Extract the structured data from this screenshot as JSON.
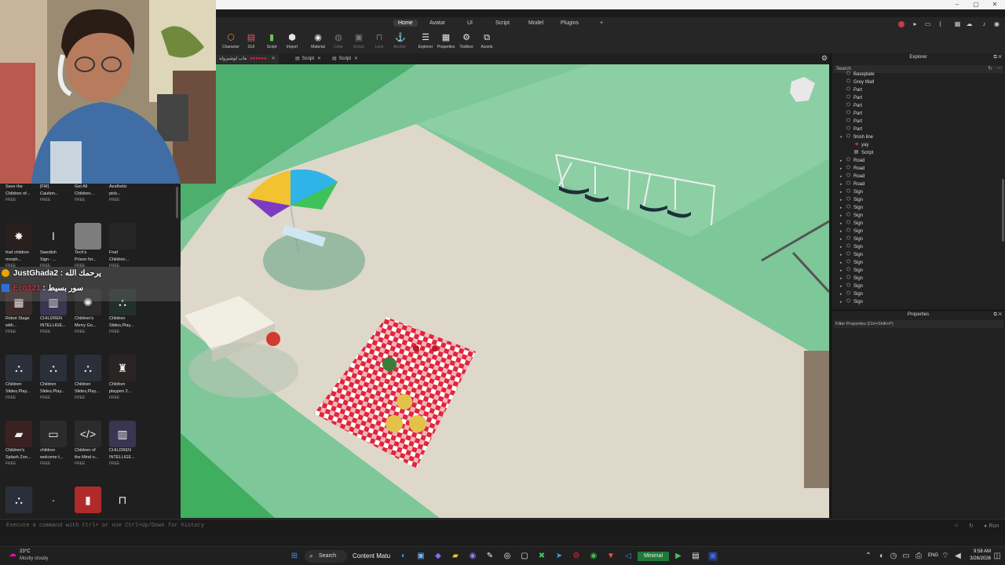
{
  "window": {
    "min": "–",
    "max": "▢",
    "close": "✕"
  },
  "menu_tabs": [
    {
      "label": "Home",
      "active": true
    },
    {
      "label": "Avatar"
    },
    {
      "label": "UI"
    },
    {
      "label": "Script"
    },
    {
      "label": "Model"
    },
    {
      "label": "Plugins"
    },
    {
      "label": "+"
    }
  ],
  "toolbar": [
    {
      "label": "Character",
      "icon": "⬡"
    },
    {
      "label": "GUI",
      "icon": "▤"
    },
    {
      "label": "Script",
      "icon": "▮"
    },
    {
      "label": "Import",
      "icon": "⬢"
    },
    {
      "label": "Material",
      "icon": "◉"
    },
    {
      "label": "Color",
      "icon": "◍",
      "dim": true
    },
    {
      "label": "Group",
      "icon": "▣",
      "dim": true
    },
    {
      "label": "Lock",
      "icon": "🔒",
      "dim": true
    },
    {
      "label": "Anchor",
      "icon": "⚓",
      "dim": true
    },
    {
      "label": "Explorer",
      "icon": "☰"
    },
    {
      "label": "Properties",
      "icon": "▦"
    },
    {
      "label": "Toolbox",
      "icon": "⚙"
    },
    {
      "label": "Assets",
      "icon": "⧉"
    }
  ],
  "doc_tabs": [
    {
      "label": "ماب لوشيروله",
      "close": "✕"
    },
    {
      "label": "Script",
      "close": "✕"
    },
    {
      "label": "Script",
      "close": "✕"
    }
  ],
  "explorer": {
    "title": "Explorer",
    "search_placeholder": "Search",
    "items": [
      {
        "label": "Baseplate",
        "depth": 1,
        "icon": "part"
      },
      {
        "label": "Grey Wall",
        "depth": 1,
        "icon": "part"
      },
      {
        "label": "Part",
        "depth": 1,
        "icon": "part"
      },
      {
        "label": "Part",
        "depth": 1,
        "icon": "part"
      },
      {
        "label": "Part",
        "depth": 1,
        "icon": "part"
      },
      {
        "label": "Part",
        "depth": 1,
        "icon": "part"
      },
      {
        "label": "Part",
        "depth": 1,
        "icon": "part"
      },
      {
        "label": "Part",
        "depth": 1,
        "icon": "part"
      },
      {
        "label": "finish line",
        "depth": 1,
        "icon": "part",
        "expanded": true
      },
      {
        "label": "yay",
        "depth": 2,
        "icon": "sound"
      },
      {
        "label": "Script",
        "depth": 2,
        "icon": "script"
      },
      {
        "label": "Road",
        "depth": 1,
        "icon": "part",
        "collapsed": true
      },
      {
        "label": "Road",
        "depth": 1,
        "icon": "part",
        "collapsed": true
      },
      {
        "label": "Road",
        "depth": 1,
        "icon": "part",
        "collapsed": true
      },
      {
        "label": "Road",
        "depth": 1,
        "icon": "part",
        "collapsed": true
      },
      {
        "label": "Sign",
        "depth": 1,
        "icon": "part",
        "collapsed": true
      },
      {
        "label": "Sign",
        "depth": 1,
        "icon": "part",
        "collapsed": true
      },
      {
        "label": "Sign",
        "depth": 1,
        "icon": "part",
        "collapsed": true
      },
      {
        "label": "Sign",
        "depth": 1,
        "icon": "part",
        "collapsed": true
      },
      {
        "label": "Sign",
        "depth": 1,
        "icon": "part",
        "collapsed": true
      },
      {
        "label": "Sign",
        "depth": 1,
        "icon": "part",
        "collapsed": true
      },
      {
        "label": "Sign",
        "depth": 1,
        "icon": "part",
        "collapsed": true
      },
      {
        "label": "Sign",
        "depth": 1,
        "icon": "part",
        "collapsed": true
      },
      {
        "label": "Sign",
        "depth": 1,
        "icon": "part",
        "collapsed": true
      },
      {
        "label": "Sign",
        "depth": 1,
        "icon": "part",
        "collapsed": true
      },
      {
        "label": "Sign",
        "depth": 1,
        "icon": "part",
        "collapsed": true
      },
      {
        "label": "Sign",
        "depth": 1,
        "icon": "part",
        "collapsed": true
      },
      {
        "label": "Sign",
        "depth": 1,
        "icon": "part",
        "collapsed": true
      },
      {
        "label": "Sign",
        "depth": 1,
        "icon": "part",
        "collapsed": true
      },
      {
        "label": "Sign",
        "depth": 1,
        "icon": "part",
        "collapsed": true
      }
    ]
  },
  "properties": {
    "title": "Properties",
    "filter_placeholder": "Filter Properties (Ctrl+Shift+P)"
  },
  "toolbox": {
    "items": [
      {
        "name": "Save the",
        "sub": "Children of...",
        "price": "FREE",
        "thumb": "",
        "color": "#1f1f1f"
      },
      {
        "name": "[FM]",
        "sub": "Caution...",
        "price": "FREE",
        "thumb": "",
        "color": "#1f1f1f"
      },
      {
        "name": "Get All",
        "sub": "Children...",
        "price": "FREE",
        "thumb": "",
        "color": "#1f1f1f"
      },
      {
        "name": "Aesthetic",
        "sub": "pink...",
        "price": "FREE",
        "thumb": "",
        "color": "#1f1f1f"
      },
      {
        "name": "fnaf children",
        "sub": "morph...",
        "price": "FREE",
        "thumb": "✸",
        "color": "#2a1f1f"
      },
      {
        "name": "Swedish",
        "sub": "Sign - ...",
        "price": "FREE",
        "thumb": "ǀ",
        "color": "#1f1f1f"
      },
      {
        "name": "Tech's",
        "sub": "Prison for...",
        "price": "FREE",
        "thumb": "",
        "color": "#7d7d7d"
      },
      {
        "name": "Fnaf",
        "sub": "Children...",
        "price": "FREE",
        "thumb": "",
        "color": "#262626"
      },
      {
        "name": "Robot Stage",
        "sub": "with...",
        "price": "FREE",
        "thumb": "▦",
        "color": "#3b2a2a"
      },
      {
        "name": "CHILDREN",
        "sub": "INTELLIGE...",
        "price": "FREE",
        "thumb": "▥",
        "color": "#3a3550"
      },
      {
        "name": "Children's",
        "sub": "Merry Go...",
        "price": "FREE",
        "thumb": "✺",
        "color": "#2b2b2b"
      },
      {
        "name": "Children",
        "sub": "Slides,Play...",
        "price": "FREE",
        "thumb": "⛬",
        "color": "#22302a"
      },
      {
        "name": "Children",
        "sub": "Slides,Play...",
        "price": "FREE",
        "thumb": "⛬",
        "color": "#2a2f3a"
      },
      {
        "name": "Children",
        "sub": "Slides,Play...",
        "price": "FREE",
        "thumb": "⛬",
        "color": "#2a2f3a"
      },
      {
        "name": "Children",
        "sub": "Slides,Play...",
        "price": "FREE",
        "thumb": "⛬",
        "color": "#2a2f3a"
      },
      {
        "name": "Children",
        "sub": "playpen 2...",
        "price": "FREE",
        "thumb": "♜",
        "color": "#2a2424"
      },
      {
        "name": "Children's",
        "sub": "Splash Zon...",
        "price": "FREE",
        "thumb": "▰",
        "color": "#3a2222"
      },
      {
        "name": "children",
        "sub": "welcome t...",
        "price": "FREE",
        "thumb": "▭",
        "color": "#2b2b2b"
      },
      {
        "name": "Children of",
        "sub": "the Mind o...",
        "price": "FREE",
        "thumb": "</>",
        "color": "#2b2b2b"
      },
      {
        "name": "CHILDREN",
        "sub": "INTELLIGE...",
        "price": "FREE",
        "thumb": "▥",
        "color": "#3a3550"
      },
      {
        "name": "",
        "sub": "",
        "price": "",
        "thumb": "⛬",
        "color": "#2a2f3a"
      },
      {
        "name": "",
        "sub": "",
        "price": "",
        "thumb": "·",
        "color": "#1f1f1f"
      },
      {
        "name": "",
        "sub": "",
        "price": "",
        "thumb": "▮",
        "color": "#b02a2a"
      },
      {
        "name": "",
        "sub": "",
        "price": "",
        "thumb": "⊓",
        "color": "#1f1f1f"
      }
    ]
  },
  "chat": [
    {
      "user": "JustGhada2",
      "message": "يرحمك الله",
      "user_color": "#ffffff"
    },
    {
      "user": "Eco121",
      "message": "سور بسيط",
      "user_color": "#e0263a"
    }
  ],
  "command_bar": {
    "placeholder": "Execute a command with Ctrl+ or use Ctrl+Up/Down for history",
    "run": "Run"
  },
  "taskbar": {
    "weather_temp": "23°C",
    "weather_desc": "Mostly cloudy",
    "search_label": "Search",
    "content_label": "Content Matu",
    "minimal_label": "Minimal",
    "lang": "ENG",
    "time": "9:58 AM",
    "date": "3/26/2026"
  },
  "colors": {
    "grass": "#4caf6e",
    "sand": "#d9d4c4",
    "checker_red": "#e0263a",
    "accent": "#2f6fd8"
  }
}
